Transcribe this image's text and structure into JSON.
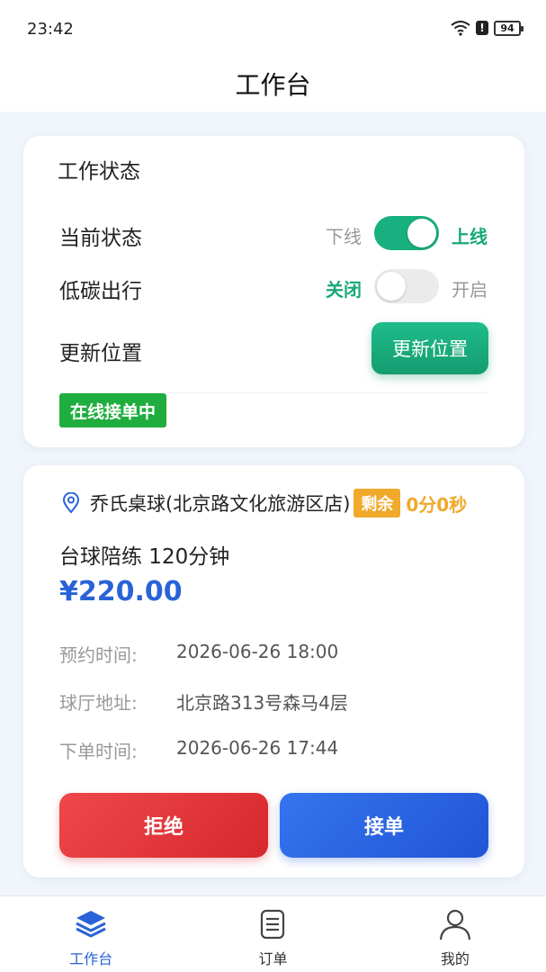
{
  "status_bar": {
    "time": "23:42",
    "battery": "94"
  },
  "header": {
    "title": "工作台"
  },
  "work_status": {
    "title": "工作状态",
    "current_state": {
      "label": "当前状态",
      "off_label": "下线",
      "on_label": "上线",
      "is_on": true
    },
    "low_carbon": {
      "label": "低碳出行",
      "off_label": "关闭",
      "on_label": "开启",
      "is_on": false
    },
    "location": {
      "label": "更新位置",
      "button_label": "更新位置"
    },
    "badge": "在线接单中"
  },
  "order": {
    "shop_name": "乔氏桌球(北京路文化旅游区店)",
    "remaining_label": "剩余",
    "remaining_time": "0分0秒",
    "service": "台球陪练 120分钟",
    "price": "¥220.00",
    "details": [
      {
        "label": "预约时间:",
        "value": "2026-06-26 18:00"
      },
      {
        "label": "球厅地址:",
        "value": "北京路313号森马4层"
      },
      {
        "label": "下单时间:",
        "value": "2026-06-26 17:44"
      }
    ],
    "reject_label": "拒绝",
    "accept_label": "接单"
  },
  "tabbar": {
    "items": [
      {
        "label": "工作台",
        "icon": "layers-icon",
        "active": true
      },
      {
        "label": "订单",
        "icon": "document-icon",
        "active": false
      },
      {
        "label": "我的",
        "icon": "user-icon",
        "active": false
      }
    ]
  },
  "colors": {
    "green": "#19b07f",
    "blue": "#2a62d8",
    "red": "#d6282d",
    "orange": "#f0a92b"
  }
}
